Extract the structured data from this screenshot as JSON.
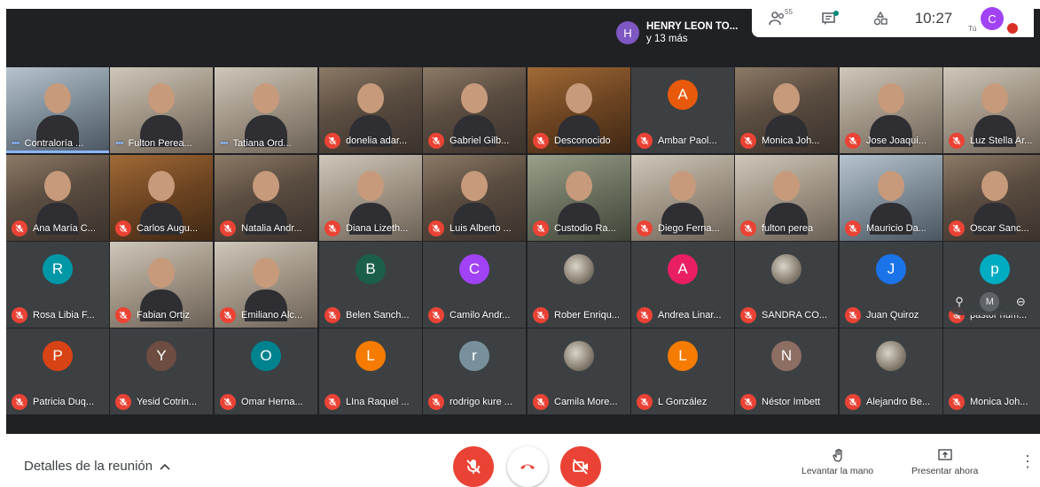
{
  "presenter": {
    "initial": "H",
    "name": "HENRY LEON TO...",
    "extra": "y 13 más"
  },
  "toolbar": {
    "participant_count": "55",
    "time": "10:27",
    "self_initial": "C",
    "self_label": "Tú"
  },
  "tiles": [
    {
      "name": "Contraloría ...",
      "kind": "cam",
      "tone": "blue",
      "mic": "speaking"
    },
    {
      "name": "Fulton Perea...",
      "kind": "cam",
      "tone": "light",
      "mic": "speaking"
    },
    {
      "name": "Tatiana Ord...",
      "kind": "cam",
      "tone": "light",
      "mic": "speaking"
    },
    {
      "name": "donelia adar...",
      "kind": "cam",
      "tone": "",
      "mic": "off"
    },
    {
      "name": "Gabriel Gilb...",
      "kind": "cam",
      "tone": "",
      "mic": "off"
    },
    {
      "name": "Desconocido",
      "kind": "cam",
      "tone": "wood",
      "mic": "off"
    },
    {
      "name": "Ambar Paol...",
      "kind": "avatar",
      "initial": "A",
      "color": "#e8590c",
      "mic": "off"
    },
    {
      "name": "Monica Joh...",
      "kind": "cam",
      "tone": "",
      "mic": "off"
    },
    {
      "name": "Jose Joaqui...",
      "kind": "cam",
      "tone": "light",
      "mic": "off"
    },
    {
      "name": "Luz Stella Ar...",
      "kind": "cam",
      "tone": "light",
      "mic": "off"
    },
    {
      "name": "Ana María C...",
      "kind": "cam",
      "tone": "",
      "mic": "off"
    },
    {
      "name": "Carlos Augu...",
      "kind": "cam",
      "tone": "wood",
      "mic": "off"
    },
    {
      "name": "Natalia Andr...",
      "kind": "cam",
      "tone": "",
      "mic": "off"
    },
    {
      "name": "Diana Lizeth...",
      "kind": "cam",
      "tone": "light",
      "mic": "off"
    },
    {
      "name": "Luis Alberto ...",
      "kind": "cam",
      "tone": "",
      "mic": "off"
    },
    {
      "name": "Custodio Ra...",
      "kind": "cam",
      "tone": "green",
      "mic": "off"
    },
    {
      "name": "Diego Ferna...",
      "kind": "cam",
      "tone": "light",
      "mic": "off"
    },
    {
      "name": "fulton perea",
      "kind": "cam",
      "tone": "light",
      "mic": "off"
    },
    {
      "name": "Mauricio Da...",
      "kind": "cam",
      "tone": "blue",
      "mic": "off"
    },
    {
      "name": "Oscar Sanc...",
      "kind": "cam",
      "tone": "",
      "mic": "off"
    },
    {
      "name": "Rosa Libia F...",
      "kind": "avatar",
      "initial": "R",
      "color": "#0097a7",
      "mic": "off"
    },
    {
      "name": "Fabian Ortiz",
      "kind": "cam",
      "tone": "light",
      "mic": "off"
    },
    {
      "name": "Emiliano Alc...",
      "kind": "cam",
      "tone": "light",
      "mic": "off"
    },
    {
      "name": "Belen Sanch...",
      "kind": "avatar",
      "initial": "B",
      "color": "#1b5e4a",
      "mic": "off"
    },
    {
      "name": "Camilo Andr...",
      "kind": "avatar",
      "initial": "C",
      "color": "#a142f4",
      "mic": "off"
    },
    {
      "name": "Rober Enriqu...",
      "kind": "avatar",
      "initial": "",
      "photo": true,
      "mic": "off"
    },
    {
      "name": "Andrea Linar...",
      "kind": "avatar",
      "initial": "A",
      "color": "#e91e63",
      "mic": "off"
    },
    {
      "name": "SANDRA CO...",
      "kind": "avatar",
      "initial": "",
      "photo": true,
      "mic": "off"
    },
    {
      "name": "Juan Quiroz",
      "kind": "avatar",
      "initial": "J",
      "color": "#1a73e8",
      "mic": "off"
    },
    {
      "name": "pastor hum...",
      "kind": "avatar",
      "initial": "p",
      "color": "#00acc1",
      "mic": "off"
    },
    {
      "name": "Patricia Duq...",
      "kind": "avatar",
      "initial": "P",
      "color": "#d84315",
      "mic": "off"
    },
    {
      "name": "Yesid Cotrin...",
      "kind": "avatar",
      "initial": "Y",
      "color": "#6d4c41",
      "mic": "off"
    },
    {
      "name": "Omar Herna...",
      "kind": "avatar",
      "initial": "O",
      "color": "#00838f",
      "mic": "off"
    },
    {
      "name": "LIna Raquel ...",
      "kind": "avatar",
      "initial": "L",
      "color": "#f57c00",
      "mic": "off"
    },
    {
      "name": "rodrigo kure ...",
      "kind": "avatar",
      "initial": "r",
      "color": "#78909c",
      "mic": "off"
    },
    {
      "name": "Camila More...",
      "kind": "avatar",
      "initial": "",
      "photo": true,
      "mic": "off"
    },
    {
      "name": "L González",
      "kind": "avatar",
      "initial": "L",
      "color": "#f57c00",
      "mic": "off"
    },
    {
      "name": "Néstor Imbett",
      "kind": "avatar",
      "initial": "N",
      "color": "#8d6e63",
      "mic": "off"
    },
    {
      "name": "Alejandro Be...",
      "kind": "avatar",
      "initial": "",
      "photo": true,
      "mic": "off"
    },
    {
      "name": "Monica Joh...",
      "kind": "none",
      "mic": "off"
    }
  ],
  "tile_tools": {
    "initial": "M"
  },
  "bottom": {
    "details_label": "Detalles de la reunión",
    "raise_hand_label": "Levantar la mano",
    "present_label": "Presentar ahora"
  },
  "colors": {
    "end_call": "#ea4335",
    "mic_off": "#ea4335",
    "accent": "#8ab4f8"
  }
}
